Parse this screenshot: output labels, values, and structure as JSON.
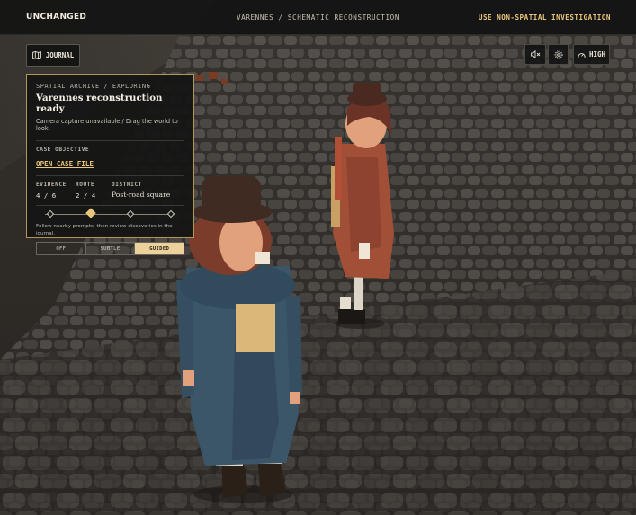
{
  "topbar": {
    "brand": "UNCHANGED",
    "breadcrumb": "VARENNES / SCHEMATIC RECONSTRUCTION",
    "alt_mode_link": "USE NON-SPATIAL INVESTIGATION"
  },
  "controls": {
    "journal_label": "JOURNAL",
    "mute_icon": "speaker-muted-icon",
    "settings_icon": "gear-icon",
    "quality_label": "HIGH",
    "quality_icon": "gauge-icon"
  },
  "panel": {
    "kicker": "SPATIAL ARCHIVE / EXPLORING",
    "title": "Varennes reconstruction ready",
    "subtitle": "Camera capture unavailable / Drag the world to look.",
    "objective_label": "CASE OBJECTIVE",
    "objective_link": "OPEN CASE FILE",
    "stats": {
      "evidence_label": "EVIDENCE",
      "evidence_value": "4 / 6",
      "route_label": "ROUTE",
      "route_value": "2 / 4",
      "district_label": "DISTRICT",
      "district_value": "Post-road square"
    },
    "progress": {
      "total_nodes": 4,
      "active_index": 1
    },
    "hint": "Follow nearby prompts, then review discoveries in the journal.",
    "guidance_modes": [
      "OFF",
      "SUBTLE",
      "GUIDED"
    ],
    "guidance_selected": "GUIDED"
  },
  "colors": {
    "accent": "#e9c67a",
    "panel_border": "#b39554",
    "selected_fill": "#ecd29a"
  }
}
